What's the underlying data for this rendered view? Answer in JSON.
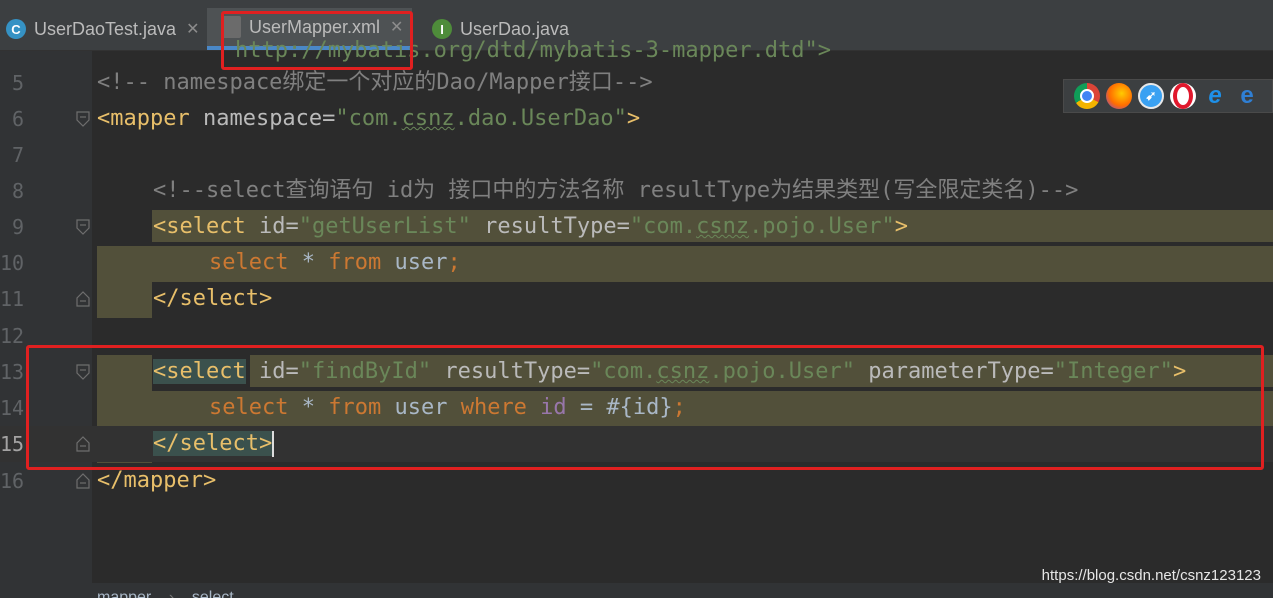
{
  "tabs": [
    {
      "label": "UserDaoTest.java",
      "icon": "C"
    },
    {
      "label": "UserMapper.xml",
      "icon": "xml"
    },
    {
      "label": "UserDao.java",
      "icon": "I"
    }
  ],
  "top_partial_line": "http://mybatis.org/dtd/mybatis-3-mapper.dtd\">",
  "lines": {
    "n5": "5",
    "n6": "6",
    "n7": "7",
    "n8": "8",
    "n9": "9",
    "n10": "10",
    "n11": "11",
    "n12": "12",
    "n13": "13",
    "n14": "14",
    "n15": "15",
    "n16": "16"
  },
  "code": {
    "l5_comment": "<!-- namespace绑定一个对应的Dao/Mapper接口-->",
    "l6_open": "<mapper",
    "l6_attr": " namespace=",
    "l6_val_a": "\"com.",
    "l6_val_b": "csnz",
    "l6_val_c": ".dao.UserDao\"",
    "l6_close": ">",
    "l8_comment": "<!--select查询语句 id为 接口中的方法名称 resultType为结果类型(写全限定类名)-->",
    "l9_open": "<select",
    "l9_attr1": " id=",
    "l9_val1": "\"getUserList\"",
    "l9_attr2": " resultType=",
    "l9_val2a": "\"com.",
    "l9_val2b": "csnz",
    "l9_val2c": ".pojo.User\"",
    "l9_close": ">",
    "l10_kw1": "select",
    "l10_mid": " * ",
    "l10_kw2": "from",
    "l10_id": " user",
    "l10_semi": ";",
    "l11": "</select>",
    "l13_open": "<select",
    "l13_attr1": " id=",
    "l13_val1": "\"findById\"",
    "l13_attr2": " resultType=",
    "l13_val2a": "\"com.",
    "l13_val2b": "csnz",
    "l13_val2c": ".pojo.User\"",
    "l13_attr3": " parameterType=",
    "l13_val3": "\"Integer\"",
    "l13_close": ">",
    "l14_kw1": "select",
    "l14_mid": " * ",
    "l14_kw2": "from",
    "l14_id": " user ",
    "l14_kw3": "where",
    "l14_fld": " id",
    "l14_rest": " = #{id}",
    "l14_semi": ";",
    "l15": "</select>",
    "l16": "</mapper>"
  },
  "browser_icons": [
    "chrome-icon",
    "firefox-icon",
    "safari-icon",
    "opera-icon",
    "ie-icon",
    "edge-icon"
  ],
  "breadcrumb": {
    "item1": "mapper",
    "sep": "›",
    "item2": "select"
  },
  "watermark": "https://blog.csdn.net/csnz123123",
  "colors": {
    "background": "#2b2b2b",
    "tag": "#e8bf6a",
    "string": "#6a8759",
    "keyword": "#cc7832",
    "comment": "#808080",
    "highlight": "#52503a",
    "annotation_box": "#e02020"
  }
}
